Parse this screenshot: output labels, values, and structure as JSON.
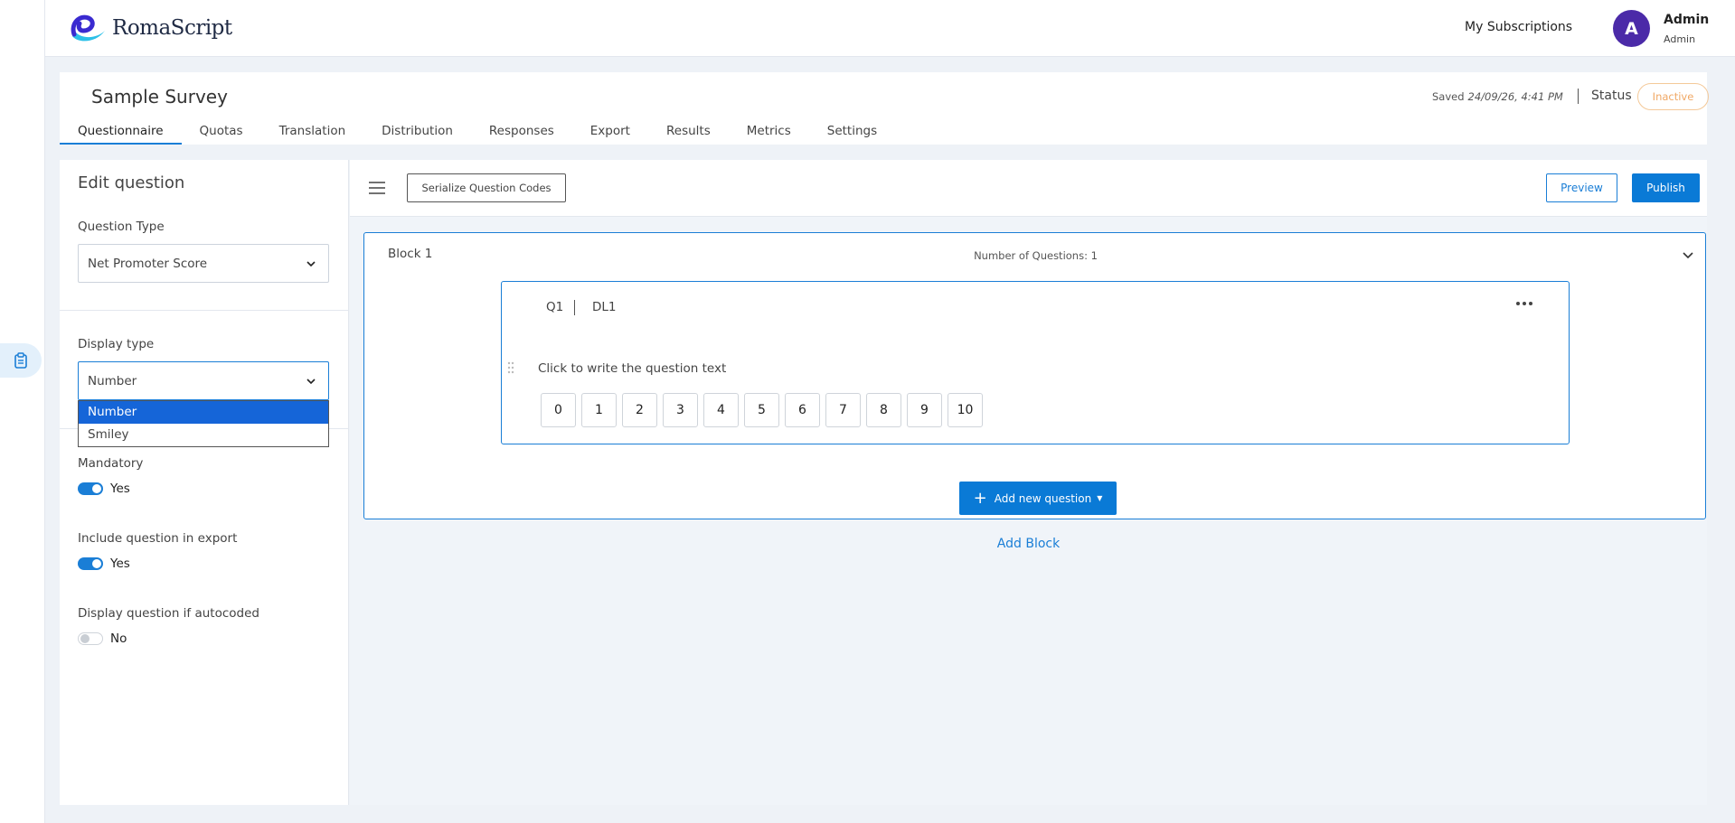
{
  "header": {
    "logo_text": "RomaScript",
    "subscriptions_label": "My Subscriptions",
    "avatar_initial": "A",
    "user_name": "Admin",
    "user_role": "Admin"
  },
  "survey": {
    "title": "Sample Survey",
    "saved_label": "Saved",
    "saved_time": "24/09/26, 4:41 PM",
    "status_label": "Status",
    "status_value": "Inactive",
    "status_color": "#f0a865",
    "tabs": [
      {
        "label": "Questionnaire",
        "active": true
      },
      {
        "label": "Quotas"
      },
      {
        "label": "Translation"
      },
      {
        "label": "Distribution"
      },
      {
        "label": "Responses"
      },
      {
        "label": "Export"
      },
      {
        "label": "Results"
      },
      {
        "label": "Metrics"
      },
      {
        "label": "Settings"
      }
    ]
  },
  "edit_panel": {
    "title": "Edit question",
    "question_type_label": "Question Type",
    "question_type_value": "Net Promoter Score",
    "display_type_label": "Display type",
    "display_type_value": "Number",
    "display_type_options": [
      "Number",
      "Smiley"
    ],
    "mandatory_label": "Mandatory",
    "mandatory_value": "Yes",
    "export_label": "Include question in export",
    "export_value": "Yes",
    "autocoded_label": "Display question if autocoded",
    "autocoded_value": "No"
  },
  "toolbar": {
    "serialize_label": "Serialize Question Codes",
    "preview_label": "Preview",
    "publish_label": "Publish"
  },
  "block": {
    "title": "Block 1",
    "count_text": "Number of Questions: 1",
    "question": {
      "code": "Q1",
      "label": "DL1",
      "text": "Click to write the question text",
      "scale": [
        "0",
        "1",
        "2",
        "3",
        "4",
        "5",
        "6",
        "7",
        "8",
        "9",
        "10"
      ]
    },
    "add_question_label": "Add new question"
  },
  "add_block_label": "Add Block",
  "colors": {
    "accent": "#1a7ed6",
    "primary_button": "#0a7ad6",
    "avatar": "#4b2aa8",
    "selected_option": "#1565d8"
  }
}
